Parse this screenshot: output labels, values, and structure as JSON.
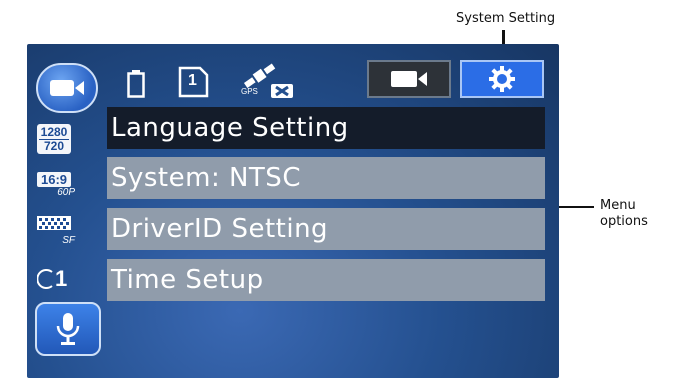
{
  "callouts": {
    "system_setting": "System Setting",
    "menu_options_line1": "Menu",
    "menu_options_line2": "options"
  },
  "status_bar": {
    "sd_slot": "1",
    "gps_label": "GPS"
  },
  "side_panel": {
    "resolution_top": "1280",
    "resolution_bottom": "720",
    "aspect_ratio": "16:9",
    "frame_rate": "60P",
    "quality": "SF",
    "loop": "1"
  },
  "menu": {
    "items": [
      {
        "label": "Language Setting",
        "selected": true
      },
      {
        "label": "System: NTSC",
        "selected": false
      },
      {
        "label": "DriverID Setting",
        "selected": false
      },
      {
        "label": "Time Setup",
        "selected": false
      }
    ]
  },
  "icons": {
    "mode": "video-camera-icon",
    "battery": "battery-icon",
    "sd": "sd-card-icon",
    "gps": "gps-satellite-icon",
    "video_tab": "video-camera-icon",
    "settings_tab": "gear-icon",
    "mic": "microphone-icon"
  },
  "colors": {
    "menu_selected": "#141c2a",
    "menu_normal": "#909cab",
    "settings_tab": "#2b6de6"
  }
}
